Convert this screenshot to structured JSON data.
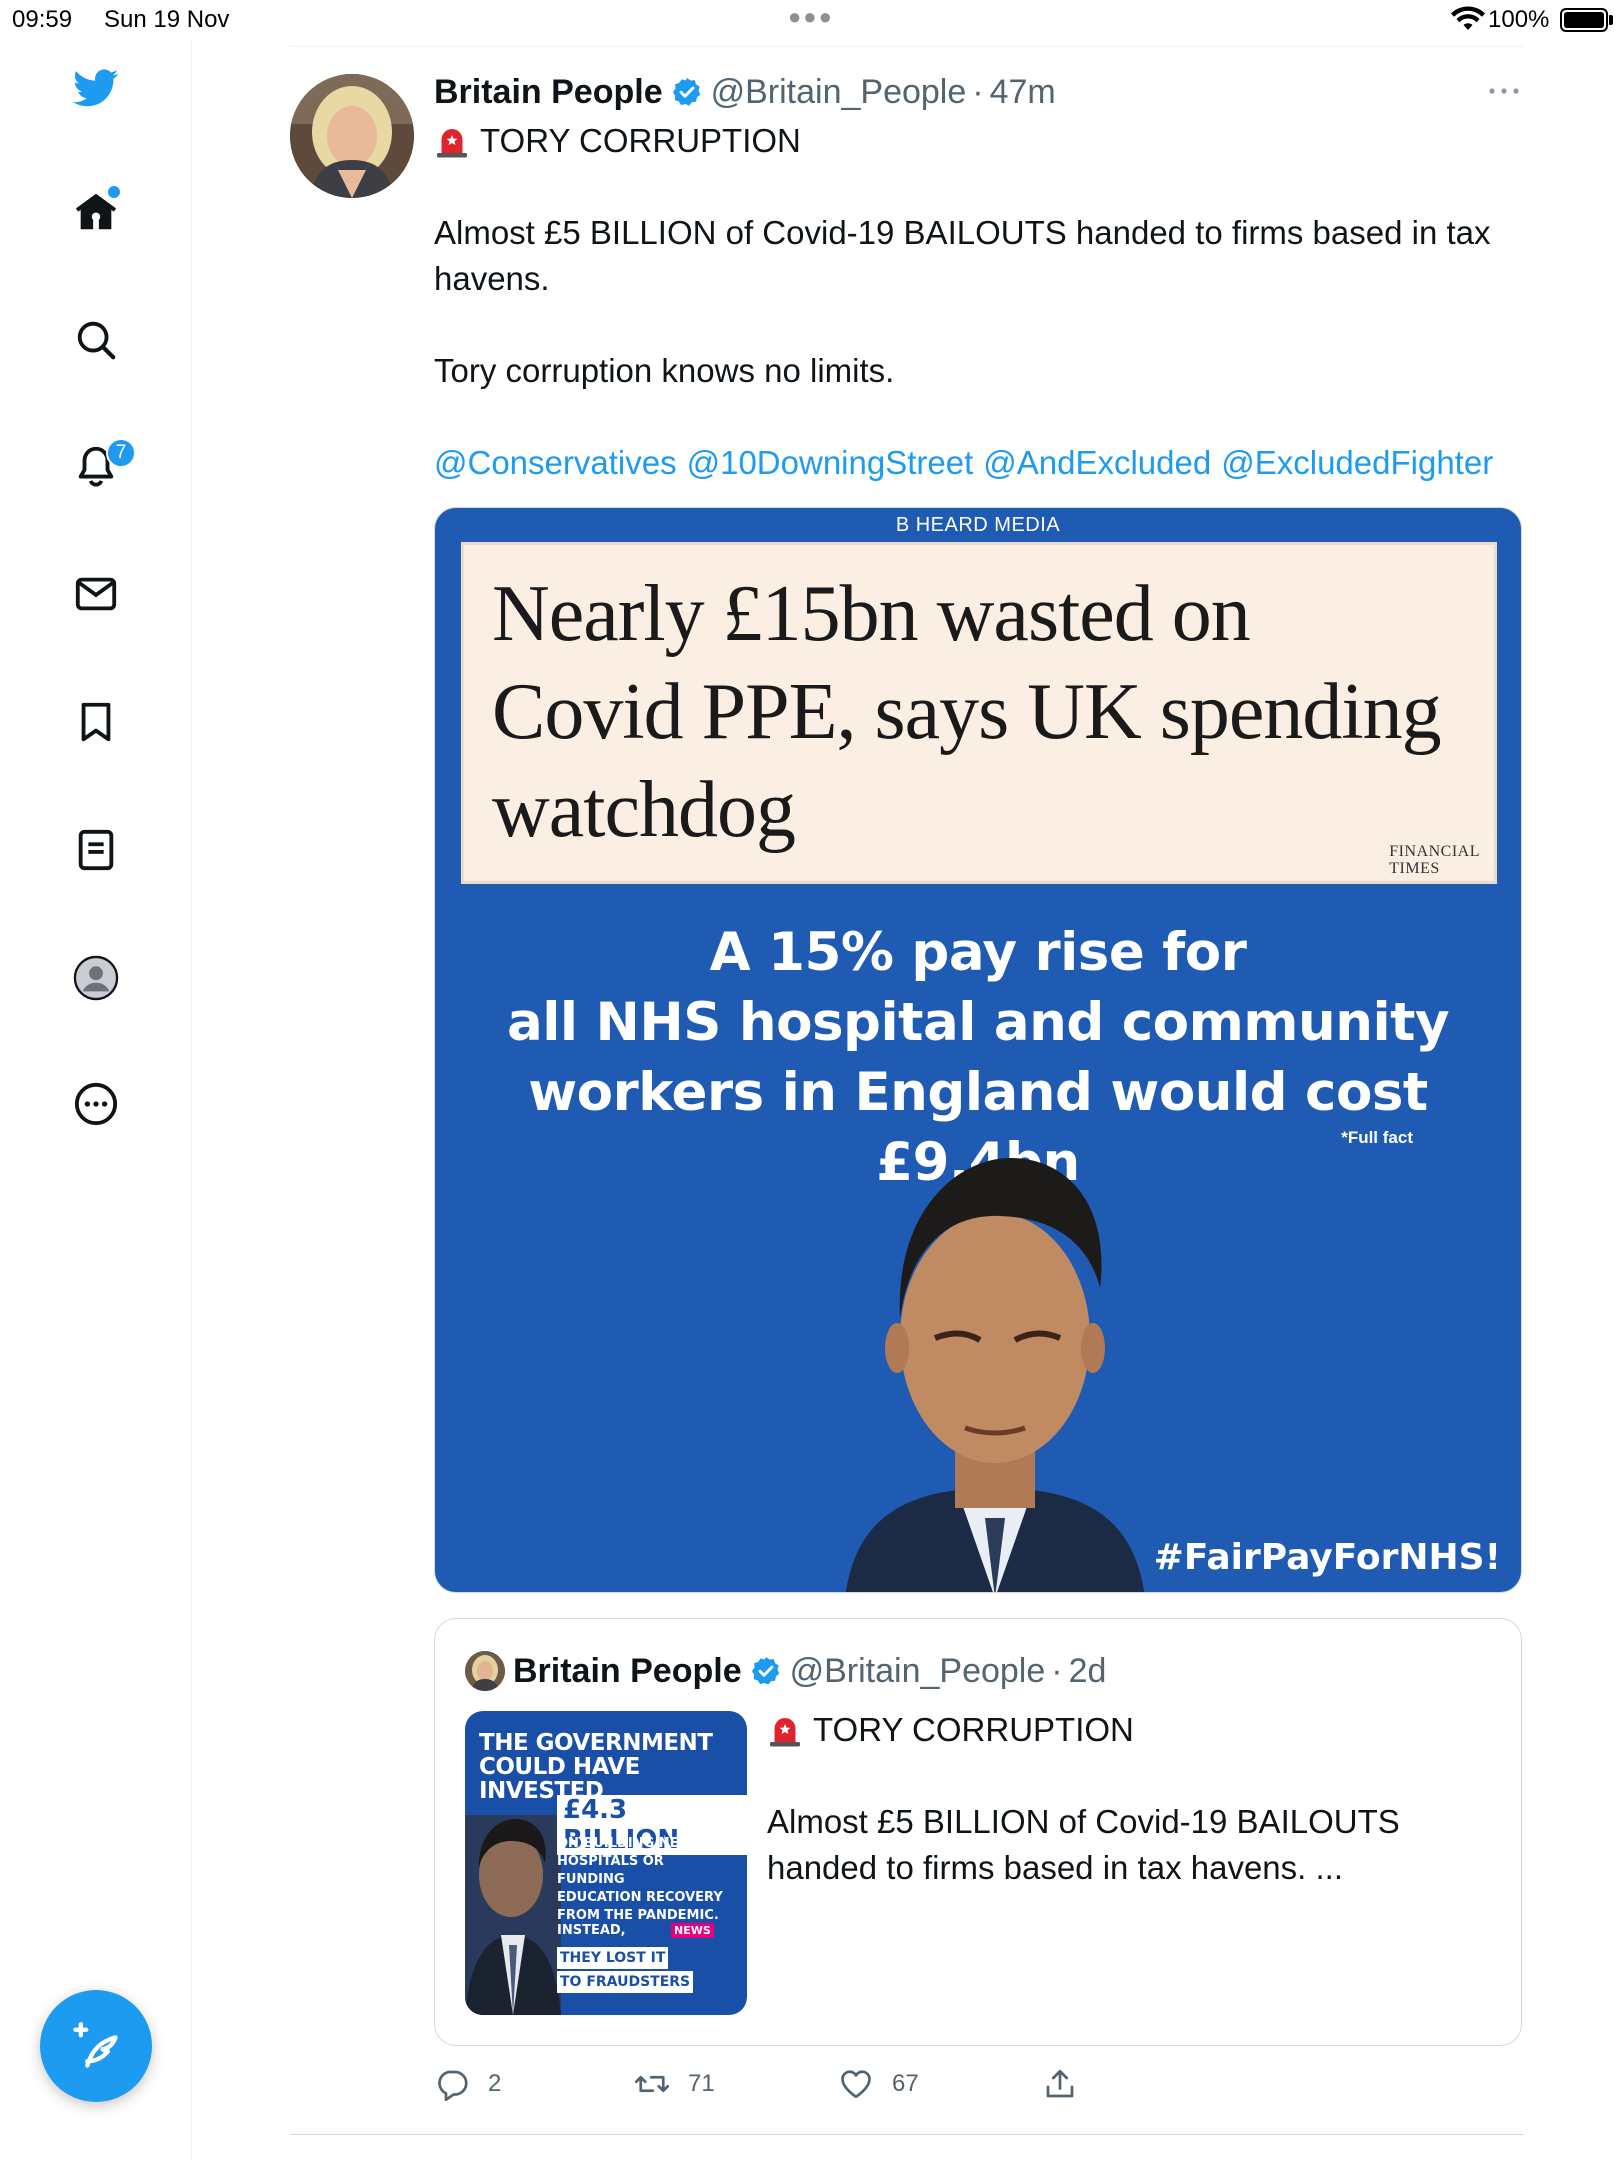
{
  "status_bar": {
    "time": "09:59",
    "date": "Sun 19 Nov",
    "battery": "100%"
  },
  "sidebar": {
    "items": [
      {
        "name": "twitter-logo",
        "icon": "bird-icon"
      },
      {
        "name": "home",
        "icon": "home-icon"
      },
      {
        "name": "explore",
        "icon": "search-icon"
      },
      {
        "name": "notifications",
        "icon": "bell-icon",
        "badge": "7"
      },
      {
        "name": "messages",
        "icon": "envelope-icon"
      },
      {
        "name": "bookmarks",
        "icon": "bookmark-icon"
      },
      {
        "name": "lists",
        "icon": "list-icon"
      },
      {
        "name": "profile",
        "icon": "profile-icon"
      },
      {
        "name": "more",
        "icon": "more-circle-icon"
      }
    ],
    "compose_icon": "feather-plus-icon"
  },
  "tweet": {
    "author_name": "Britain People",
    "handle": "@Britain_People",
    "separator": "·",
    "age": "47m",
    "title": "TORY CORRUPTION",
    "paragraph_1": "Almost £5 BILLION of Covid-19 BAILOUTS handed to firms based in tax havens.",
    "paragraph_2": "Tory corruption knows no limits.",
    "mentions": [
      "@Conservatives",
      "@10DowningStreet",
      "@AndExcluded",
      "@ExcludedFighter"
    ]
  },
  "media": {
    "source": "B HEARD MEDIA",
    "headline": "Nearly £15bn wasted on Covid PPE, says UK spending watchdog",
    "publisher_line_1": "FINANCIAL",
    "publisher_line_2": "TIMES",
    "claim_line_1": "A 15% pay rise for",
    "claim_line_2": "all NHS hospital and community",
    "claim_line_3": "workers in England would cost £9.4bn",
    "footnote": "*Full fact",
    "hashtag": "#FairPayForNHS!"
  },
  "quoted_tweet": {
    "author_name": "Britain People",
    "handle": "@Britain_People",
    "separator": "·",
    "age": "2d",
    "title": "TORY CORRUPTION",
    "text": "Almost £5 BILLION of Covid-19 BAILOUTS handed to firms based in tax havens.  ...",
    "thumbnail": {
      "title_line_1": "THE GOVERNMENT",
      "title_line_2": "COULD HAVE INVESTED",
      "amount": "£4.3 BILLION",
      "sub_1": "ON BUILDING NEW",
      "sub_2": "HOSPITALS OR FUNDING",
      "sub_3": "EDUCATION RECOVERY",
      "sub_4": "FROM THE PANDEMIC.",
      "instead": "INSTEAD,",
      "lost_1": "THEY LOST IT",
      "lost_2": "TO FRAUDSTERS",
      "news_badge": "NEWS"
    }
  },
  "actions": {
    "replies": "2",
    "retweets": "71",
    "likes": "67"
  },
  "colors": {
    "accent": "#1d9bf0",
    "media_background": "#1f5bb3",
    "headline_background": "#fbeee2",
    "secondary_text": "#536471"
  }
}
